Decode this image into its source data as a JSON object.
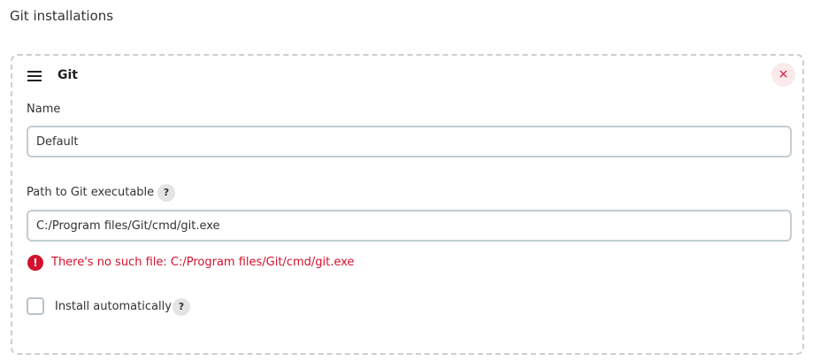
{
  "section": {
    "title": "Git installations"
  },
  "installation": {
    "title": "Git",
    "delete_glyph": "×",
    "name": {
      "label": "Name",
      "value": "Default"
    },
    "path": {
      "label": "Path to Git executable",
      "help_glyph": "?",
      "value": "C:/Program files/Git/cmd/git.exe",
      "error": {
        "glyph": "!",
        "message": "There's no such file: C:/Program files/Git/cmd/git.exe"
      }
    },
    "install_automatically": {
      "label": "Install automatically",
      "checked": false,
      "help_glyph": "?"
    }
  },
  "colors": {
    "error": "#d3112d",
    "border": "#c3ccd3",
    "dashed_border": "#c9cfd4",
    "delete_bg": "#fbe9ec"
  }
}
